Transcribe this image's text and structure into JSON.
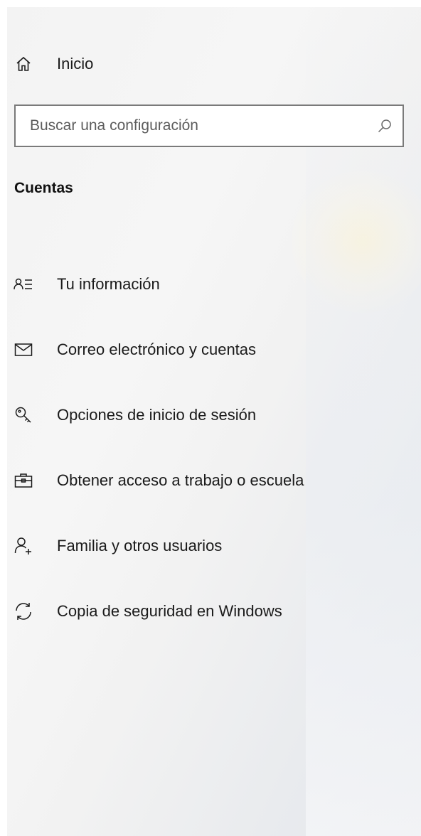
{
  "home": {
    "label": "Inicio",
    "icon": "home-icon"
  },
  "search": {
    "placeholder": "Buscar una configuración",
    "value": "",
    "icon": "search-icon"
  },
  "section": {
    "title": "Cuentas"
  },
  "nav": [
    {
      "label": "Tu información",
      "icon": "user-info-icon"
    },
    {
      "label": "Correo electrónico y cuentas",
      "icon": "mail-icon"
    },
    {
      "label": "Opciones de inicio de sesión",
      "icon": "key-icon"
    },
    {
      "label": "Obtener acceso a trabajo o escuela",
      "icon": "briefcase-icon"
    },
    {
      "label": "Familia y otros usuarios",
      "icon": "add-user-icon"
    },
    {
      "label": "Copia de seguridad en Windows",
      "icon": "sync-icon"
    }
  ]
}
